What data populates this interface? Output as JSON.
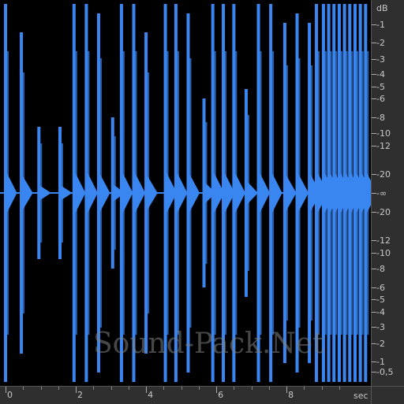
{
  "app": {
    "watermark": "Sound-Pack.Net",
    "colors": {
      "background": "#000000",
      "waveform": "#3a86f0",
      "ruler_bg": "#2f2f2f",
      "ruler_text": "#c8c8c8"
    }
  },
  "db_ruler": {
    "unit": "dB",
    "labels": [
      {
        "text": "-1",
        "level": -1,
        "half": "top"
      },
      {
        "text": "-2",
        "level": -2,
        "half": "top"
      },
      {
        "text": "-3",
        "level": -3,
        "half": "top"
      },
      {
        "text": "-4",
        "level": -4,
        "half": "top"
      },
      {
        "text": "-5",
        "level": -5,
        "half": "top"
      },
      {
        "text": "-6",
        "level": -6,
        "half": "top"
      },
      {
        "text": "-8",
        "level": -8,
        "half": "top"
      },
      {
        "text": "-10",
        "level": -10,
        "half": "top"
      },
      {
        "text": "-12",
        "level": -12,
        "half": "top"
      },
      {
        "text": "-20",
        "level": -20,
        "half": "top"
      },
      {
        "text": "-∞",
        "level": null,
        "half": "center"
      },
      {
        "text": "-20",
        "level": -20,
        "half": "bottom"
      },
      {
        "text": "-12",
        "level": -12,
        "half": "bottom"
      },
      {
        "text": "-10",
        "level": -10,
        "half": "bottom"
      },
      {
        "text": "-8",
        "level": -8,
        "half": "bottom"
      },
      {
        "text": "-6",
        "level": -6,
        "half": "bottom"
      },
      {
        "text": "-5",
        "level": -5,
        "half": "bottom"
      },
      {
        "text": "-4",
        "level": -4,
        "half": "bottom"
      },
      {
        "text": "-3",
        "level": -3,
        "half": "bottom"
      },
      {
        "text": "-2",
        "level": -2,
        "half": "bottom"
      },
      {
        "text": "-1",
        "level": -1,
        "half": "bottom"
      },
      {
        "text": "-0,5",
        "level": -0.5,
        "half": "bottom"
      }
    ]
  },
  "time_ruler": {
    "unit": "sec",
    "labels": [
      "0",
      "2",
      "4",
      "6",
      "8"
    ],
    "label_seconds": [
      0,
      2,
      4,
      6,
      8
    ],
    "visible_span_seconds": 10.4
  },
  "waveform": {
    "hits": [
      {
        "t": 0.0,
        "amp": 1.0
      },
      {
        "t": 0.45,
        "amp": 0.85
      },
      {
        "t": 0.95,
        "amp": 0.35
      },
      {
        "t": 1.55,
        "amp": 0.35
      },
      {
        "t": 1.95,
        "amp": 1.0
      },
      {
        "t": 2.3,
        "amp": 1.0
      },
      {
        "t": 2.65,
        "amp": 0.95
      },
      {
        "t": 3.05,
        "amp": 0.4
      },
      {
        "t": 3.3,
        "amp": 1.0
      },
      {
        "t": 3.65,
        "amp": 1.0
      },
      {
        "t": 4.0,
        "amp": 0.85
      },
      {
        "t": 4.55,
        "amp": 1.0
      },
      {
        "t": 4.85,
        "amp": 1.0
      },
      {
        "t": 5.2,
        "amp": 0.95
      },
      {
        "t": 5.65,
        "amp": 0.5
      },
      {
        "t": 5.9,
        "amp": 1.0
      },
      {
        "t": 6.2,
        "amp": 1.0
      },
      {
        "t": 6.5,
        "amp": 1.0
      },
      {
        "t": 6.85,
        "amp": 0.55
      },
      {
        "t": 7.2,
        "amp": 1.0
      },
      {
        "t": 7.55,
        "amp": 1.0
      },
      {
        "t": 7.95,
        "amp": 0.9
      },
      {
        "t": 8.3,
        "amp": 0.95
      },
      {
        "t": 8.65,
        "amp": 0.9
      },
      {
        "t": 8.85,
        "amp": 1.0
      },
      {
        "t": 9.05,
        "amp": 1.0
      },
      {
        "t": 9.2,
        "amp": 1.0
      },
      {
        "t": 9.35,
        "amp": 1.0
      },
      {
        "t": 9.5,
        "amp": 1.0
      },
      {
        "t": 9.65,
        "amp": 1.0
      },
      {
        "t": 9.8,
        "amp": 1.0
      },
      {
        "t": 9.95,
        "amp": 1.0
      },
      {
        "t": 10.1,
        "amp": 1.0
      },
      {
        "t": 10.25,
        "amp": 1.0
      }
    ],
    "dense_region_seconds": [
      8.95,
      10.4
    ]
  }
}
